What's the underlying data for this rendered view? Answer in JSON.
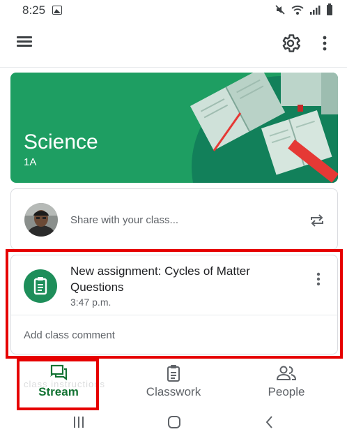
{
  "status_bar": {
    "time": "8:25",
    "icons": [
      "gallery-icon",
      "mute-icon",
      "wifi-icon",
      "signal-icon",
      "battery-icon"
    ]
  },
  "app_bar": {
    "icons": [
      "menu-icon",
      "settings-icon",
      "more-vert-icon"
    ]
  },
  "class_banner": {
    "title": "Science",
    "section": "1A",
    "background_color": "#1e9e62"
  },
  "share": {
    "placeholder": "Share with your class...",
    "icon": "repost-icon"
  },
  "assignment_post": {
    "title": "New assignment: Cycles of Matter Questions",
    "time": "3:47 p.m.",
    "icon": "assignment-icon",
    "comment_link": "Add class comment",
    "icon_color": "#1e8e5a"
  },
  "bottom_nav": {
    "items": [
      {
        "label": "Stream",
        "icon": "stream-icon",
        "active": true
      },
      {
        "label": "Classwork",
        "icon": "classwork-icon",
        "active": false
      },
      {
        "label": "People",
        "icon": "people-icon",
        "active": false
      }
    ],
    "ghost_text": "class instructions",
    "active_color": "#137333"
  },
  "highlight_color": "#e60000",
  "system_nav": {
    "icons": [
      "recent-apps-icon",
      "home-icon",
      "back-icon"
    ]
  }
}
